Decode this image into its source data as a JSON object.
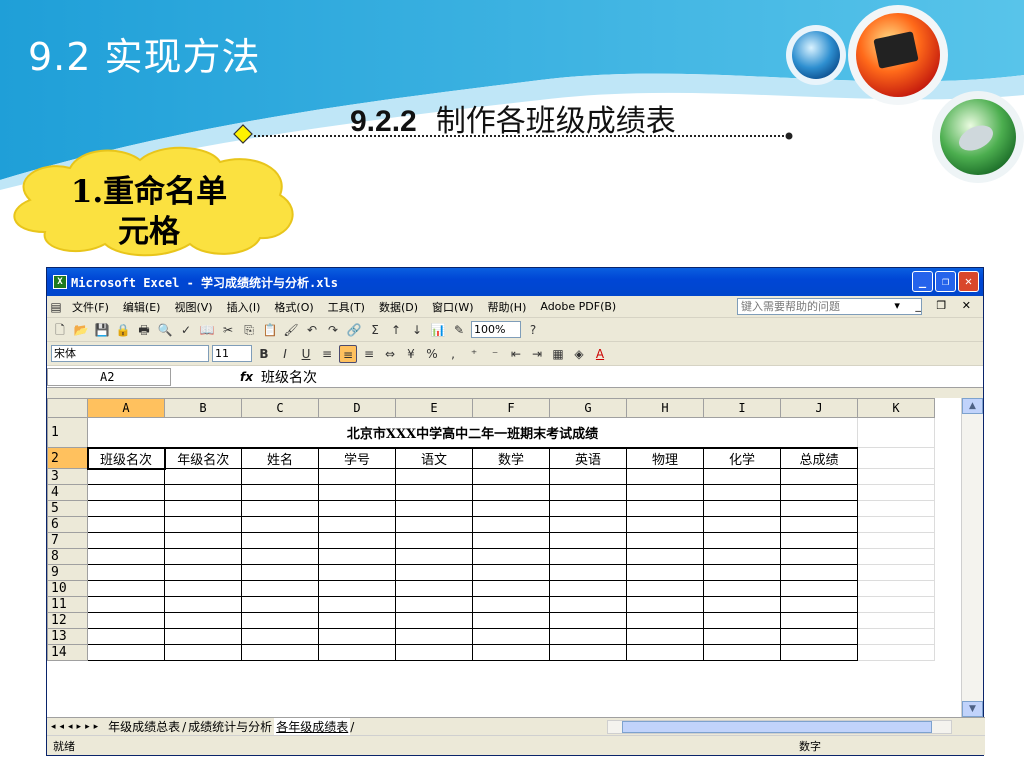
{
  "slide": {
    "section_title": "9.2  实现方法",
    "subsection_number": "9.2.2",
    "subsection_title": "制作各班级成绩表",
    "cloud_label_line1": "1.重命名单",
    "cloud_label_line2": "元格"
  },
  "excel": {
    "window_title": "Microsoft Excel - 学习成绩统计与分析.xls",
    "menu": [
      "文件(F)",
      "编辑(E)",
      "视图(V)",
      "插入(I)",
      "格式(O)",
      "工具(T)",
      "数据(D)",
      "窗口(W)",
      "帮助(H)",
      "Adobe PDF(B)"
    ],
    "help_placeholder": "键入需要帮助的问题",
    "zoom": "100%",
    "font_name": "宋体",
    "font_size": "11",
    "name_box": "A2",
    "formula_value": "班级名次",
    "columns": [
      "A",
      "B",
      "C",
      "D",
      "E",
      "F",
      "G",
      "H",
      "I",
      "J",
      "K"
    ],
    "rows": [
      "1",
      "2",
      "3",
      "4",
      "5",
      "6",
      "7",
      "8",
      "9",
      "10",
      "11",
      "12",
      "13",
      "14"
    ],
    "sheet_title": "北京市XXX中学高中二年一班期末考试成绩",
    "headers": [
      "班级名次",
      "年级名次",
      "姓名",
      "学号",
      "语文",
      "数学",
      "英语",
      "物理",
      "化学",
      "总成绩"
    ],
    "sheet_tabs": [
      "年级成绩总表",
      "成绩统计与分析",
      "各年级成绩表"
    ],
    "status_left": "就绪",
    "status_num": "数字",
    "colors": {
      "title_blue": "#0046d5",
      "header_active": "#ffc15e",
      "slide_blue": "#1aa0dc"
    }
  }
}
